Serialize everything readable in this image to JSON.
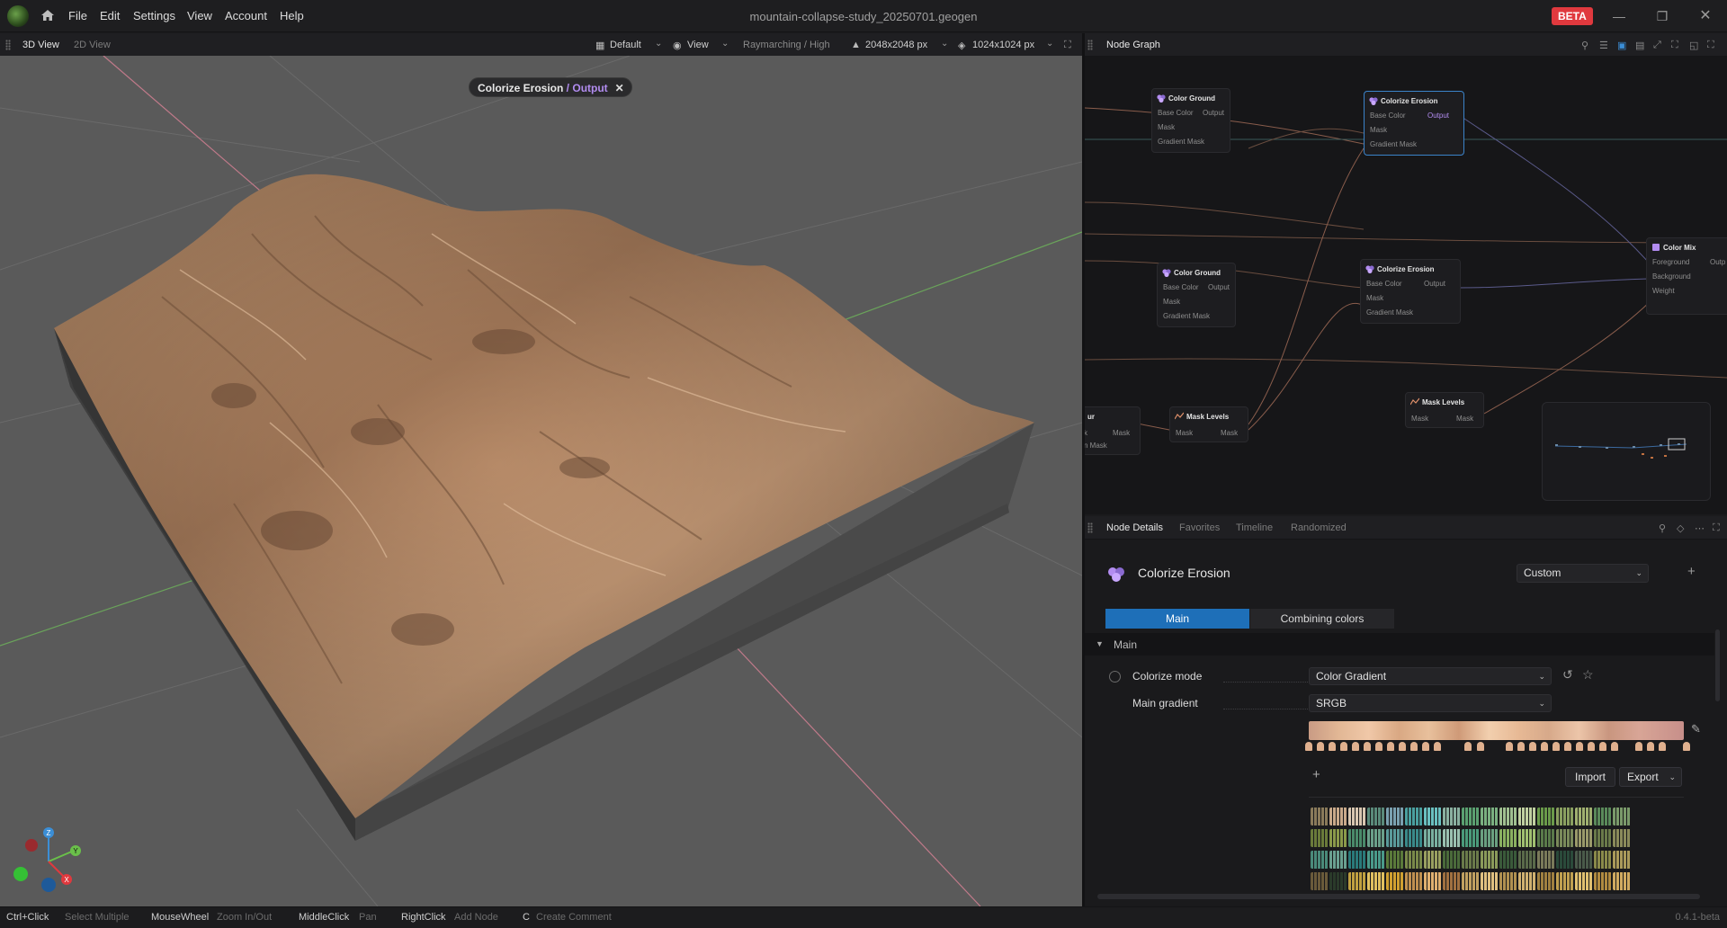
{
  "title_bar": {
    "menu": [
      "File",
      "Edit",
      "Settings",
      "View",
      "Account",
      "Help"
    ],
    "window_title": "mountain-collapse-study_20250701.geogen",
    "badge": "BETA",
    "window_buttons": [
      "minimize",
      "maximize",
      "close"
    ]
  },
  "viewport_header": {
    "tabs": [
      "3D View",
      "2D View"
    ],
    "preset": "Default",
    "view": "View",
    "render_mode": "Raymarching / High",
    "resolution": "2048x2048 px",
    "preview_resolution": "1024x1024 px"
  },
  "viewport": {
    "chip_node": "Colorize Erosion",
    "chip_sep": " / ",
    "chip_output": "Output",
    "axes": [
      "Z",
      "Y",
      "X"
    ]
  },
  "node_graph": {
    "title": "Node Graph",
    "nodes": [
      {
        "title": "Color Ground",
        "inputs": [
          "Base Color",
          "Mask",
          "Gradient Mask"
        ],
        "output": "Output"
      },
      {
        "title": "Colorize Erosion",
        "inputs": [
          "Base Color",
          "Mask",
          "Gradient Mask"
        ],
        "output": "Output"
      },
      {
        "title": "Color Ground",
        "inputs": [
          "Base Color",
          "Mask",
          "Gradient Mask"
        ],
        "output": "Output"
      },
      {
        "title": "Colorize Erosion",
        "inputs": [
          "Base Color",
          "Mask",
          "Gradient Mask"
        ],
        "output": "Output"
      },
      {
        "title": "Color Mix",
        "inputs": [
          "Foreground",
          "Background",
          "Weight"
        ],
        "output": "Outp"
      },
      {
        "title": "Mask Levels",
        "inputs": [
          "Mask"
        ],
        "output": "Mask"
      },
      {
        "title": "Mask Levels",
        "inputs": [
          "Mask"
        ],
        "output": "Mask"
      },
      {
        "title": "ur",
        "inputs": [
          "k",
          "n Mask"
        ],
        "output": "Mask"
      }
    ]
  },
  "details": {
    "tabs": [
      "Node Details",
      "Favorites",
      "Timeline",
      "Randomized"
    ],
    "node_name": "Colorize Erosion",
    "preset": "Custom",
    "sub_tabs": [
      "Main",
      "Combining colors"
    ],
    "section": "Main",
    "props": [
      {
        "label": "Colorize mode",
        "value": "Color Gradient"
      },
      {
        "label": "Main gradient",
        "value": "SRGB"
      }
    ],
    "import_label": "Import",
    "export_label": "Export",
    "add_symbol": "+"
  },
  "status_bar": {
    "hints": [
      {
        "key": "Ctrl+Click",
        "action": "Select Multiple"
      },
      {
        "key": "MouseWheel",
        "action": "Zoom In/Out"
      },
      {
        "key": "MiddleClick",
        "action": "Pan"
      },
      {
        "key": "RightClick",
        "action": "Add Node"
      },
      {
        "key": "C",
        "action": "Create Comment"
      }
    ],
    "version": "0.4.1-beta"
  },
  "colors": {
    "accent_blue": "#1e6fb8",
    "output_purple": "#b28cf0",
    "beta_red": "#e0393e",
    "terrain": "#b98a66"
  }
}
